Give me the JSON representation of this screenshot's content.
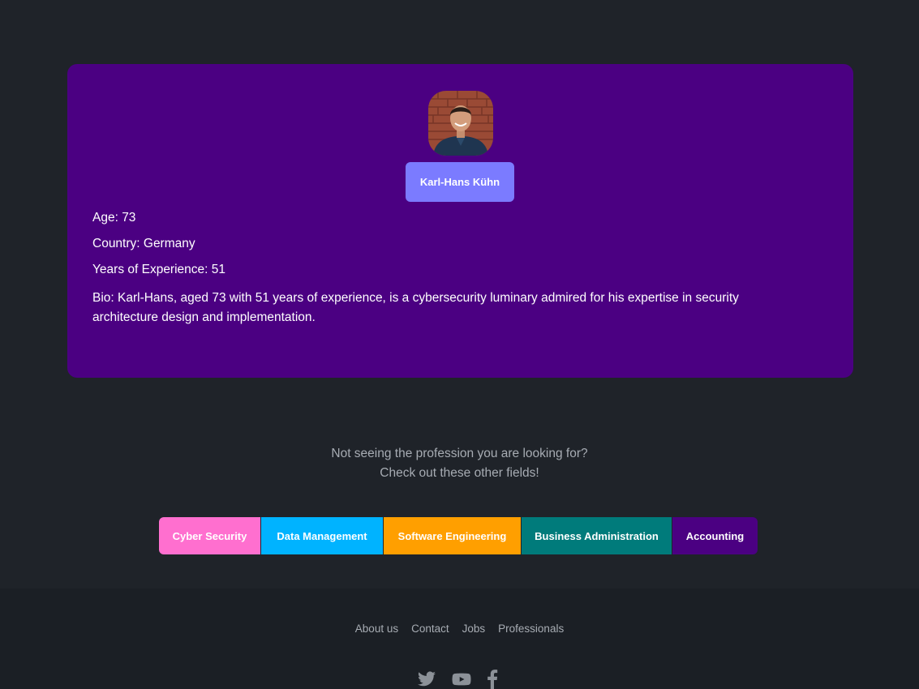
{
  "profile": {
    "name": "Karl-Hans Kühn",
    "age_line": "Age: 73",
    "country_line": "Country: Germany",
    "experience_line": "Years of Experience: 51",
    "bio_line": "Bio: Karl-Hans, aged 73 with 51 years of experience, is a cybersecurity luminary admired for his expertise in security architecture design and implementation."
  },
  "prompt": {
    "line1": "Not seeing the profession you are looking for?",
    "line2": "Check out these other fields!"
  },
  "fields": [
    {
      "label": "Cyber Security",
      "color": "#ff6fcf"
    },
    {
      "label": "Data Management",
      "color": "#00b3ff"
    },
    {
      "label": "Software Engineering",
      "color": "#ff9f00"
    },
    {
      "label": "Business Administration",
      "color": "#007b7b"
    },
    {
      "label": "Accounting",
      "color": "#4b0082"
    }
  ],
  "footer": {
    "links": [
      "About us",
      "Contact",
      "Jobs",
      "Professionals"
    ],
    "socials": [
      "twitter-icon",
      "youtube-icon",
      "facebook-icon"
    ]
  },
  "colors": {
    "page_bg": "#1f2329",
    "card_bg": "#4b0082",
    "name_button": "#7b7bff",
    "footer_bg": "#1b1f25",
    "muted_text": "#a7acb3"
  }
}
